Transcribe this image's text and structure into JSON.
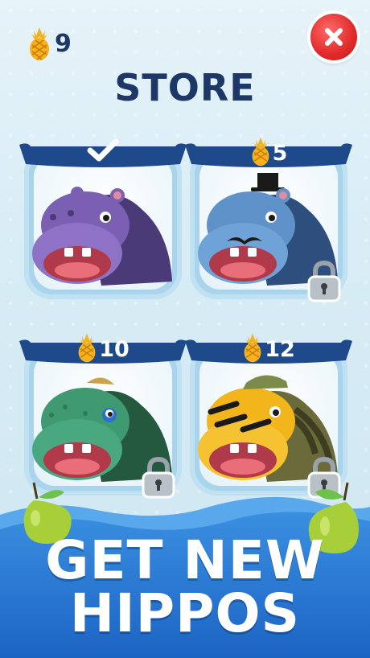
{
  "header": {
    "currency_count": "9",
    "title": "STORE"
  },
  "cards": [
    {
      "price": "",
      "status": "owned",
      "color": "#7b5fb3"
    },
    {
      "price": "5",
      "status": "locked",
      "color": "#5f92c9"
    },
    {
      "price": "10",
      "status": "locked",
      "color": "#3f9a72"
    },
    {
      "price": "12",
      "status": "locked",
      "color": "#f2b61c"
    }
  ],
  "promo": {
    "line1": "GET NEW",
    "line2": "HIPPOS"
  },
  "colors": {
    "navy": "#1d3766",
    "accent_red": "#e02a2a",
    "banner": "#1e4a8c",
    "pineapple": "#f5b21c"
  },
  "icons": {
    "currency": "pineapple-icon",
    "close": "close-icon",
    "owned": "checkmark-icon",
    "locked": "padlock-icon"
  }
}
